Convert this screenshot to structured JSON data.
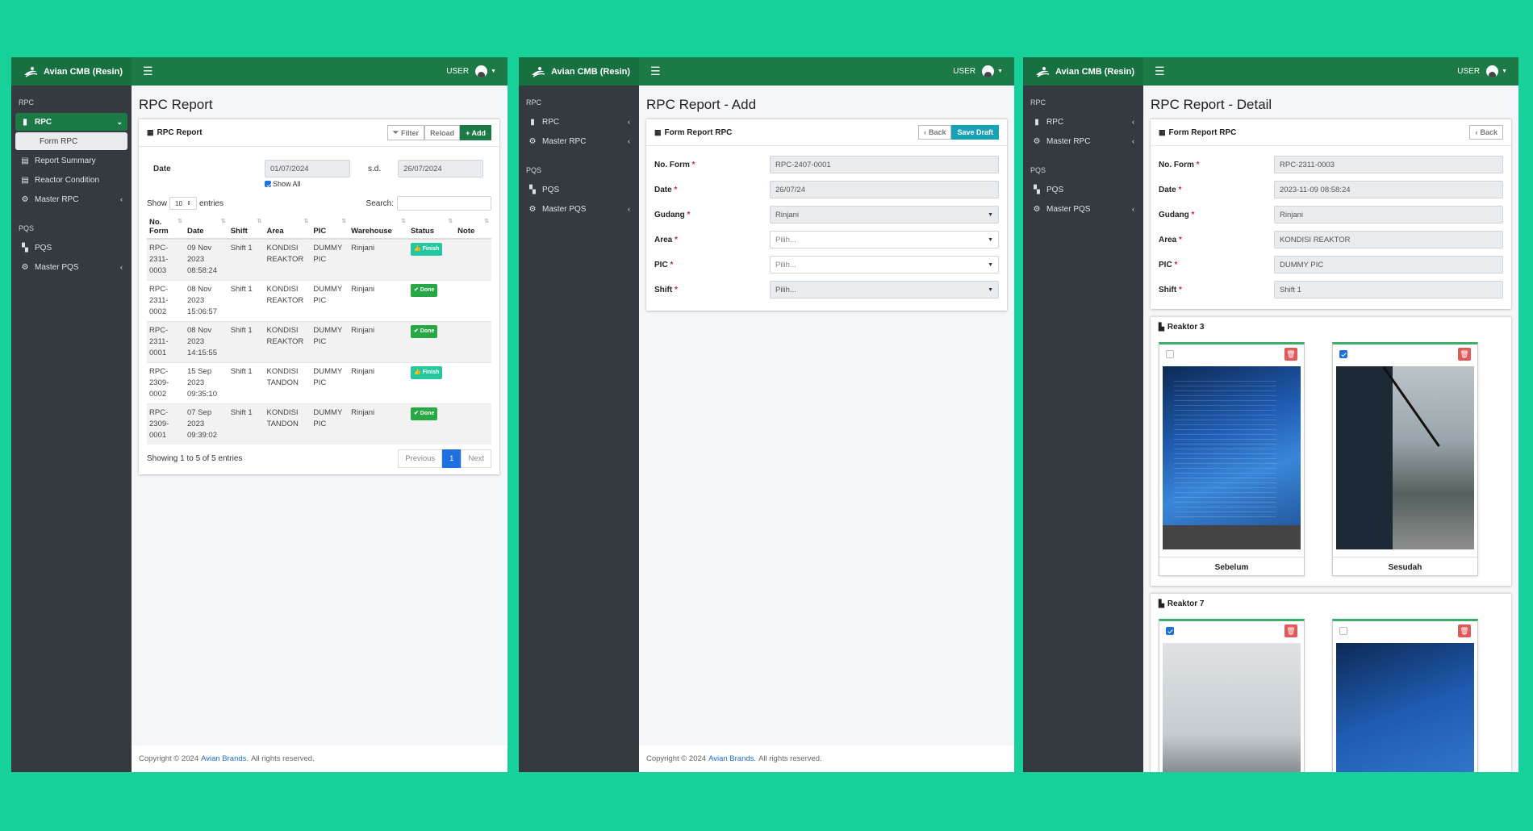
{
  "brand": "Avian CMB (Resin)",
  "user": "USER",
  "footer": {
    "prefix": "Copyright © 2024",
    "link": "Avian Brands.",
    "suffix": "All rights reserved."
  },
  "panel1": {
    "sidebar": {
      "hdr_rpc": "RPC",
      "rpc": "RPC",
      "form_rpc": "Form RPC",
      "report_summary": "Report Summary",
      "reactor_condition": "Reactor Condition",
      "master_rpc": "Master RPC",
      "hdr_pqs": "PQS",
      "pqs": "PQS",
      "master_pqs": "Master PQS"
    },
    "title": "RPC Report",
    "card_title": "RPC Report",
    "buttons": {
      "filter": "Filter",
      "reload": "Reload",
      "add": "+ Add"
    },
    "date_label": "Date",
    "date_from": "01/07/2024",
    "sd": "s.d.",
    "date_to": "26/07/2024",
    "show_all": "Show All",
    "show": "Show",
    "entries_value": "10",
    "entries": "entries",
    "search": "Search:",
    "columns": [
      "No. Form",
      "Date",
      "Shift",
      "Area",
      "PIC",
      "Warehouse",
      "Status",
      "Note"
    ],
    "rows": [
      {
        "no": "RPC-2311-0003",
        "date": "09 Nov 2023 08:58:24",
        "shift": "Shift 1",
        "area": "KONDISI REAKTOR",
        "pic": "DUMMY PIC",
        "wh": "Rinjani",
        "status": "Finish",
        "note": ""
      },
      {
        "no": "RPC-2311-0002",
        "date": "08 Nov 2023 15:06:57",
        "shift": "Shift 1",
        "area": "KONDISI REAKTOR",
        "pic": "DUMMY PIC",
        "wh": "Rinjani",
        "status": "Done",
        "note": ""
      },
      {
        "no": "RPC-2311-0001",
        "date": "08 Nov 2023 14:15:55",
        "shift": "Shift 1",
        "area": "KONDISI REAKTOR",
        "pic": "DUMMY PIC",
        "wh": "Rinjani",
        "status": "Done",
        "note": ""
      },
      {
        "no": "RPC-2309-0002",
        "date": "15 Sep 2023 09:35:10",
        "shift": "Shift 1",
        "area": "KONDISI TANDON",
        "pic": "DUMMY PIC",
        "wh": "Rinjani",
        "status": "Finish",
        "note": ""
      },
      {
        "no": "RPC-2309-0001",
        "date": "07 Sep 2023 09:39:02",
        "shift": "Shift 1",
        "area": "KONDISI TANDON",
        "pic": "DUMMY PIC",
        "wh": "Rinjani",
        "status": "Done",
        "note": ""
      }
    ],
    "info": "Showing 1 to 5 of 5 entries",
    "pagination": {
      "prev": "Previous",
      "page": "1",
      "next": "Next"
    }
  },
  "panel2": {
    "sidebar": {
      "hdr_rpc": "RPC",
      "rpc": "RPC",
      "master_rpc": "Master RPC",
      "hdr_pqs": "PQS",
      "pqs": "PQS",
      "master_pqs": "Master PQS"
    },
    "title": "RPC Report - Add",
    "card_title": "Form Report RPC",
    "buttons": {
      "back": "Back",
      "save_draft": "Save Draft"
    },
    "fields": [
      {
        "label": "No. Form",
        "value": "RPC-2407-0001"
      },
      {
        "label": "Date",
        "value": "26/07/24"
      },
      {
        "label": "Gudang",
        "value": "Rinjani"
      },
      {
        "label": "Area",
        "value": "Pilih..."
      },
      {
        "label": "PIC",
        "value": "Pilih..."
      },
      {
        "label": "Shift",
        "value": "Pilih..."
      }
    ]
  },
  "panel3": {
    "sidebar": {
      "hdr_rpc": "RPC",
      "rpc": "RPC",
      "master_rpc": "Master RPC",
      "hdr_pqs": "PQS",
      "pqs": "PQS",
      "master_pqs": "Master PQS"
    },
    "title": "RPC Report - Detail",
    "card_title": "Form Report RPC",
    "buttons": {
      "back": "Back"
    },
    "fields": [
      {
        "label": "No. Form",
        "value": "RPC-2311-0003"
      },
      {
        "label": "Date",
        "value": "2023-11-09 08:58:24"
      },
      {
        "label": "Gudang",
        "value": "Rinjani"
      },
      {
        "label": "Area",
        "value": "KONDISI REAKTOR"
      },
      {
        "label": "PIC",
        "value": "DUMMY PIC"
      },
      {
        "label": "Shift",
        "value": "Shift 1"
      }
    ],
    "reaktor3": {
      "title": "Reaktor 3",
      "before": "Sebelum",
      "after": "Sesudah"
    },
    "reaktor7": {
      "title": "Reaktor 7"
    }
  },
  "colors": {
    "primary": "#1b7a46",
    "sidebar": "#343a40",
    "background": "#17d19b",
    "finish": "#25c7a0",
    "done": "#28a745",
    "info": "#17a2b8"
  }
}
